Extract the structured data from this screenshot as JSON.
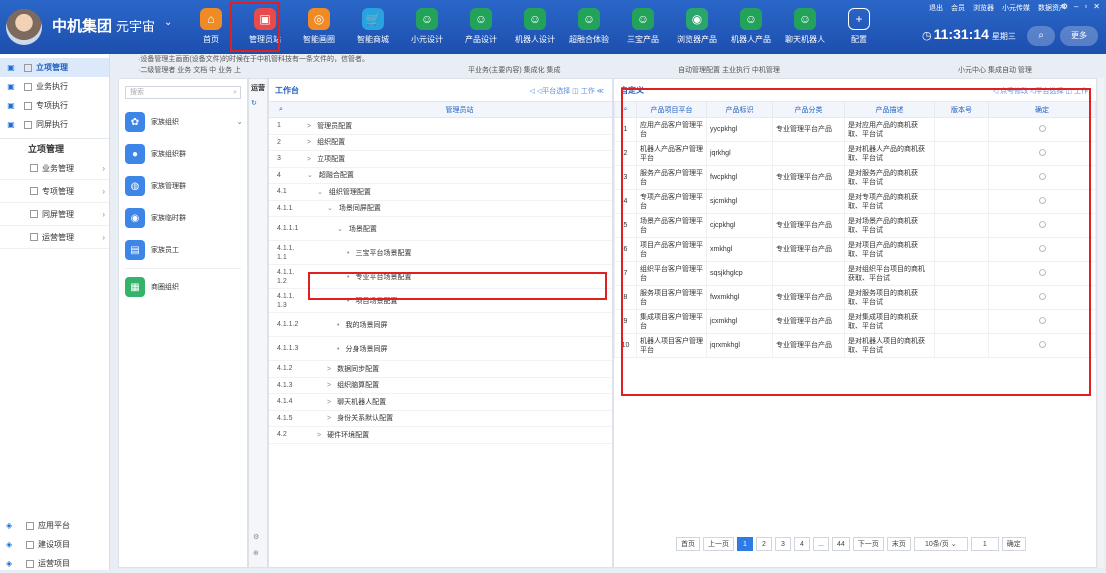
{
  "header": {
    "brand": "中机集团",
    "brand2": "元宇宙",
    "brand_chevron": "⌄",
    "nav": [
      {
        "label": "首页",
        "icon": "home-icon",
        "color": "#f08a24",
        "glyph": "⌂"
      },
      {
        "label": "管理员站",
        "icon": "admin-icon",
        "color": "#e94a4a",
        "glyph": "▣",
        "selected": true
      },
      {
        "label": "智能画圈",
        "icon": "circle-icon",
        "color": "#f08a24",
        "glyph": "◎"
      },
      {
        "label": "智能商城",
        "icon": "cart-icon",
        "color": "#29a3e0",
        "glyph": "🛒"
      },
      {
        "label": "小元设计",
        "icon": "robot-icon",
        "color": "#23a35a",
        "glyph": "☺"
      },
      {
        "label": "产品设计",
        "icon": "robot-icon",
        "color": "#23a35a",
        "glyph": "☺"
      },
      {
        "label": "机器人设计",
        "icon": "robot-icon",
        "color": "#23a35a",
        "glyph": "☺"
      },
      {
        "label": "超融合体验",
        "icon": "robot-icon",
        "color": "#23a35a",
        "glyph": "☺"
      },
      {
        "label": "三宝产品",
        "icon": "robot-icon",
        "color": "#23a35a",
        "glyph": "☺"
      },
      {
        "label": "浏览器产品",
        "icon": "browser-icon",
        "color": "#2aa56b",
        "glyph": "◉"
      },
      {
        "label": "机器人产品",
        "icon": "robot-icon",
        "color": "#23a35a",
        "glyph": "☺"
      },
      {
        "label": "聊天机器人",
        "icon": "robot-icon",
        "color": "#23a35a",
        "glyph": "☺"
      },
      {
        "label": "配置",
        "icon": "plus-icon",
        "color": "#3d74d1",
        "glyph": "+"
      }
    ],
    "top_links": [
      "退出",
      "会员",
      "浏览器",
      "小元传媒",
      "数据资产"
    ],
    "time": "11:31:14",
    "weekday": "星期三",
    "more": "更多",
    "search_glyph": "⌕",
    "clock_glyph": "◷"
  },
  "leftnav": {
    "top_items": [
      {
        "label": "立项管理",
        "icon": "grid-icon",
        "active": true
      },
      {
        "label": "业务执行",
        "icon": "monitor-icon"
      },
      {
        "label": "专项执行",
        "icon": "doc-icon"
      },
      {
        "label": "同屏执行",
        "icon": "screen-icon"
      }
    ],
    "group": "立项管理",
    "sub_items": [
      "业务管理",
      "专项管理",
      "同屏管理",
      "运营管理"
    ],
    "bottom_items": [
      {
        "label": "应用平台",
        "icon": "app-icon"
      },
      {
        "label": "建设项目",
        "icon": "build-icon"
      },
      {
        "label": "运营项目",
        "icon": "ops-icon"
      }
    ]
  },
  "notice": [
    "·设备管理主画面(设备文件)的时候在于中机管科技有一条文件的，信管者。",
    "·二级管理者 业务 文档    中 业务 上 ",
    "平业务(主要内容) 集成化 集成 ",
    "自动管理配置 主业执行 中机管理 ",
    "小元中心 集成自动 管理"
  ],
  "panel1": {
    "search_placeholder": "搜索",
    "search_glyph": "⌕",
    "items": [
      {
        "label": "家族组织",
        "color": "#3d86e8",
        "glyph": "✿"
      },
      {
        "label": "家族组织群",
        "color": "#3d86e8",
        "glyph": "●"
      },
      {
        "label": "家族管理群",
        "color": "#3d86e8",
        "glyph": "◍"
      },
      {
        "label": "家族临时群",
        "color": "#3d86e8",
        "glyph": "◉"
      },
      {
        "label": "家族员工",
        "color": "#3d86e8",
        "glyph": "▤"
      },
      {
        "label": "商圈组织",
        "color": "#36b36a",
        "glyph": "▦"
      }
    ],
    "dropdown_glyph": "⌄"
  },
  "panel2": {
    "side_label": "运营",
    "title": "工作台",
    "tools": "◁ ◁平台选择 ◫ 工作 ≪",
    "column": "管理员站",
    "rows": [
      {
        "num": "1",
        "label": "管理员配置",
        "indent": 0,
        "arrow": ">"
      },
      {
        "num": "2",
        "label": "组织配置",
        "indent": 0,
        "arrow": ">"
      },
      {
        "num": "3",
        "label": "立项配置",
        "indent": 0,
        "arrow": ">"
      },
      {
        "num": "4",
        "label": "超融合配置",
        "indent": 0,
        "arrow": "⌄"
      },
      {
        "num": "4.1",
        "label": "组织管理配置",
        "indent": 1,
        "arrow": "⌄"
      },
      {
        "num": "4.1.1",
        "label": "场景同屏配置",
        "indent": 2,
        "arrow": "⌄"
      },
      {
        "num": "4.1.1.1",
        "label": "场景配置",
        "indent": 3,
        "arrow": "⌄"
      },
      {
        "num": "4.1.1.1.1",
        "label": "三宝平台场景配置",
        "indent": 4,
        "arrow": "•"
      },
      {
        "num": "4.1.1.1.2",
        "label": "专业平台场景配置",
        "indent": 4,
        "arrow": "•",
        "highlight": true
      },
      {
        "num": "4.1.1.1.3",
        "label": "项目场景配置",
        "indent": 4,
        "arrow": "•"
      },
      {
        "num": "4.1.1.2",
        "label": "我的场景同屏",
        "indent": 3,
        "arrow": "•"
      },
      {
        "num": "4.1.1.3",
        "label": "分身场景同屏",
        "indent": 3,
        "arrow": "•"
      },
      {
        "num": "4.1.2",
        "label": "数据同步配置",
        "indent": 2,
        "arrow": ">"
      },
      {
        "num": "4.1.3",
        "label": "组织脑算配置",
        "indent": 2,
        "arrow": ">"
      },
      {
        "num": "4.1.4",
        "label": "聊天机器人配置",
        "indent": 2,
        "arrow": ">"
      },
      {
        "num": "4.1.5",
        "label": "身份关系默认配置",
        "indent": 2,
        "arrow": ">"
      },
      {
        "num": "4.2",
        "label": "硬件环境配置",
        "indent": 1,
        "arrow": ">"
      }
    ]
  },
  "panel3": {
    "title": "自定义",
    "tools": "◁ 点号修改  ◁平台选择  ◫ 工作",
    "columns": [
      "产品项目平台",
      "产品标识",
      "产品分类",
      "产品描述",
      "版本号",
      "确定"
    ],
    "rows": [
      {
        "n": "1",
        "name": "应用产品客户管理平台",
        "code": "yycpkhgl",
        "cat": "专业管理平台产品",
        "desc": "是对应用产品的商机获取、平台试"
      },
      {
        "n": "2",
        "name": "机器人产品客户管理平台",
        "code": "jqrkhgl",
        "cat": "",
        "desc": "是对机器人产品的商机获取、平台试"
      },
      {
        "n": "3",
        "name": "服务产品客户管理平台",
        "code": "fwcpkhgl",
        "cat": "专业管理平台产品",
        "desc": "是对服务产品的商机获取、平台试"
      },
      {
        "n": "4",
        "name": "专项产品客户管理平台",
        "code": "sjcmkhgl",
        "cat": "",
        "desc": "是对专项产品的商机获取、平台试"
      },
      {
        "n": "5",
        "name": "场景产品客户管理平台",
        "code": "cjcpkhgl",
        "cat": "专业管理平台产品",
        "desc": "是对场景产品的商机获取、平台试"
      },
      {
        "n": "6",
        "name": "项目产品客户管理平台",
        "code": "xmkhgl",
        "cat": "专业管理平台产品",
        "desc": "是对项目产品的商机获取、平台试"
      },
      {
        "n": "7",
        "name": "组织平台客户管理平台",
        "code": "sqsjkhglcp",
        "cat": "",
        "desc": "是对组织平台项目的商机获取、平台试"
      },
      {
        "n": "8",
        "name": "服务项目客户管理平台",
        "code": "fwxmkhgl",
        "cat": "专业管理平台产品",
        "desc": "是对服务项目的商机获取、平台试"
      },
      {
        "n": "9",
        "name": "集成项目客户管理平台",
        "code": "jcxmkhgl",
        "cat": "专业管理平台产品",
        "desc": "是对集成项目的商机获取、平台试"
      },
      {
        "n": "10",
        "name": "机器人项目客户管理平台",
        "code": "jqrxmkhgl",
        "cat": "专业管理平台产品",
        "desc": "是对机器人项目的商机获取、平台试"
      }
    ],
    "pager": [
      "首页",
      "上一页",
      "1",
      "2",
      "3",
      "4",
      "...",
      "44",
      "下一页",
      "末页",
      "10条/页 ⌄",
      "1",
      "确定"
    ]
  }
}
